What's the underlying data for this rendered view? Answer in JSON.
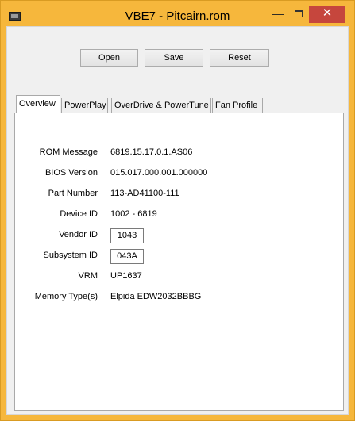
{
  "window": {
    "title": "VBE7 - Pitcairn.rom",
    "minimize": "—",
    "close": "✕"
  },
  "toolbar": {
    "open_label": "Open",
    "save_label": "Save",
    "reset_label": "Reset"
  },
  "tabs": [
    {
      "label": "Overview",
      "active": true
    },
    {
      "label": "PowerPlay",
      "active": false
    },
    {
      "label": "OverDrive & PowerTune",
      "active": false
    },
    {
      "label": "Fan Profile",
      "active": false
    }
  ],
  "overview": {
    "rom_message": {
      "label": "ROM Message",
      "value": "6819.15.17.0.1.AS06"
    },
    "bios_version": {
      "label": "BIOS Version",
      "value": "015.017.000.001.000000"
    },
    "part_number": {
      "label": "Part Number",
      "value": "113-AD41100-111"
    },
    "device_id": {
      "label": "Device ID",
      "value": "1002 - 6819"
    },
    "vendor_id": {
      "label": "Vendor ID",
      "value": "1043"
    },
    "subsystem_id": {
      "label": "Subsystem ID",
      "value": "043A"
    },
    "vrm": {
      "label": "VRM",
      "value": "UP1637"
    },
    "memory_type": {
      "label": "Memory Type(s)",
      "value": "Elpida EDW2032BBBG"
    }
  },
  "colors": {
    "frame": "#f6b73c",
    "close_button": "#c6463d"
  }
}
